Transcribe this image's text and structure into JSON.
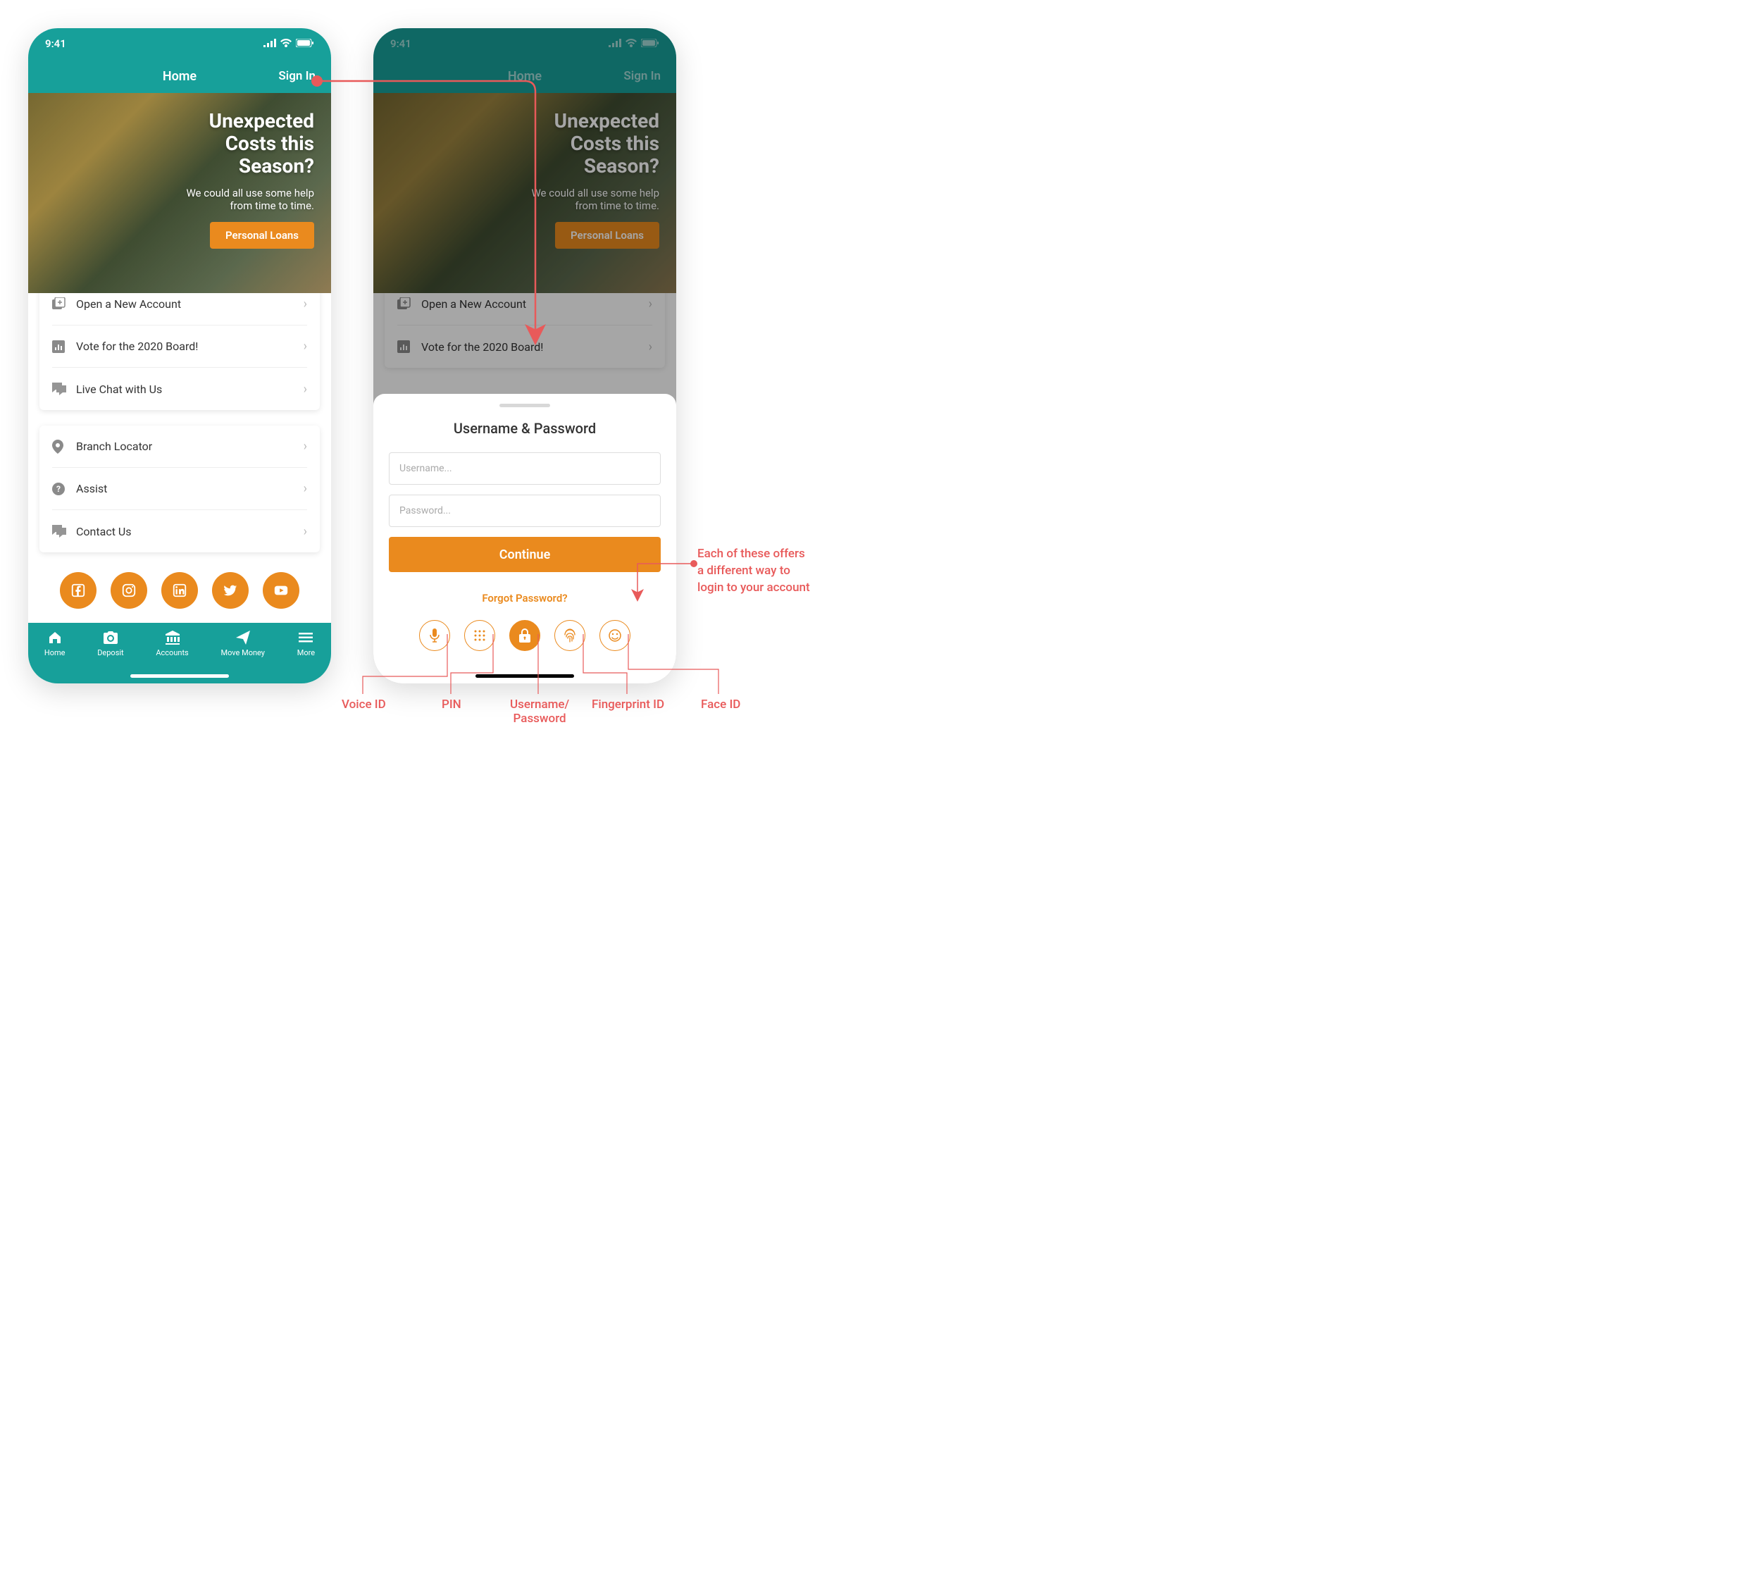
{
  "status": {
    "time": "9:41"
  },
  "nav": {
    "title": "Home",
    "signin": "Sign In"
  },
  "hero": {
    "title_l1": "Unexpected",
    "title_l2": "Costs this",
    "title_l3": "Season?",
    "sub": "We could all use some help from time to time.",
    "cta": "Personal Loans"
  },
  "card1": {
    "items": [
      {
        "label": "Open a New Account"
      },
      {
        "label": "Vote for the 2020 Board!"
      },
      {
        "label": "Live Chat with Us"
      }
    ]
  },
  "card2": {
    "items": [
      {
        "label": "Branch Locator"
      },
      {
        "label": "Assist"
      },
      {
        "label": "Contact Us"
      }
    ]
  },
  "tabs": [
    {
      "label": "Home"
    },
    {
      "label": "Deposit"
    },
    {
      "label": "Accounts"
    },
    {
      "label": "Move Money"
    },
    {
      "label": "More"
    }
  ],
  "sheet": {
    "title": "Username & Password",
    "username_ph": "Username...",
    "password_ph": "Password...",
    "continue": "Continue",
    "forgot": "Forgot Password?"
  },
  "anno": {
    "right_l1": "Each of these offers",
    "right_l2": "a different way to",
    "right_l3": "login to your account",
    "m1": "Voice ID",
    "m2": "PIN",
    "m3_l1": "Username/",
    "m3_l2": "Password",
    "m4": "Fingerprint ID",
    "m5": "Face ID"
  }
}
